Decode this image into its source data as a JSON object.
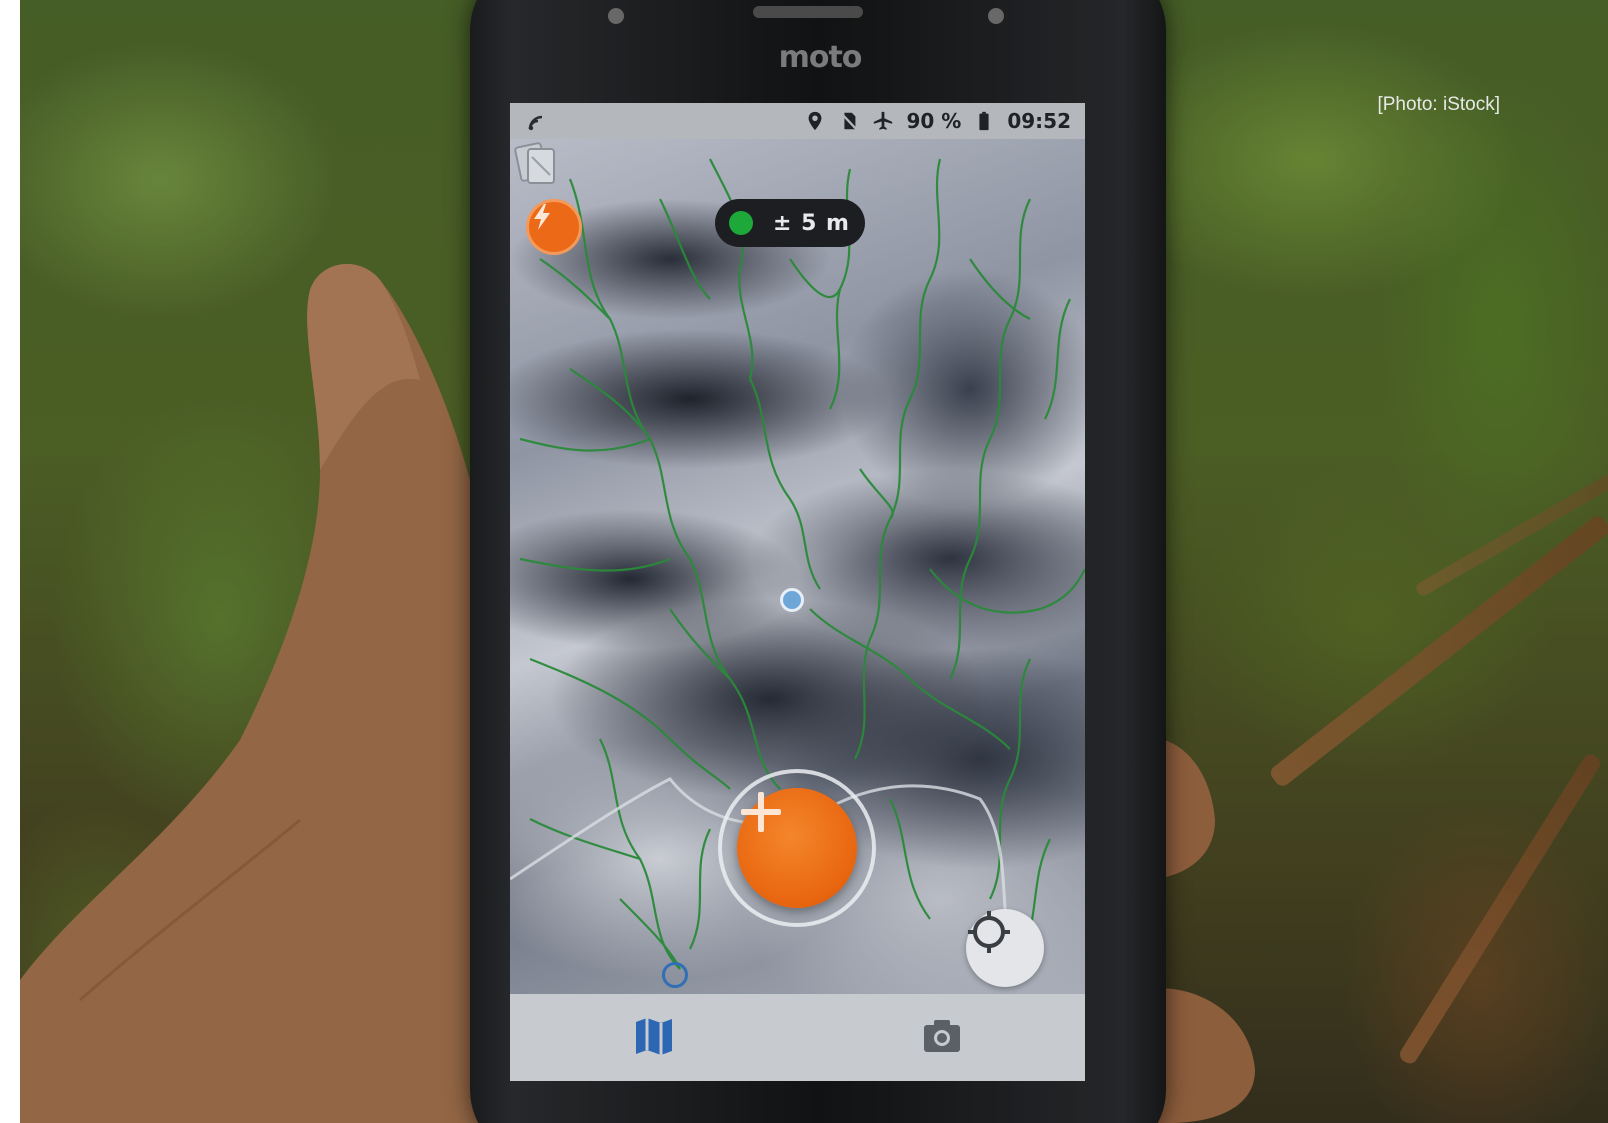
{
  "caption": "[Photo: iStock]",
  "phone": {
    "brand": "moto",
    "status_bar": {
      "battery": "90 %",
      "time": "09:52",
      "icons": [
        "signal-icon",
        "location-pin-icon",
        "no-sim-icon",
        "airplane-mode-icon",
        "battery-icon"
      ]
    },
    "gps_accuracy": "± 5 m",
    "gps_status_color": "#1ea83a",
    "accent_color": "#e8650f",
    "map_controls": [
      "power-icon",
      "layers-icon",
      "add-icon",
      "crosshair-icon"
    ],
    "bottom_nav": [
      {
        "icon": "map-icon",
        "active": true
      },
      {
        "icon": "camera-icon",
        "active": false
      }
    ]
  }
}
